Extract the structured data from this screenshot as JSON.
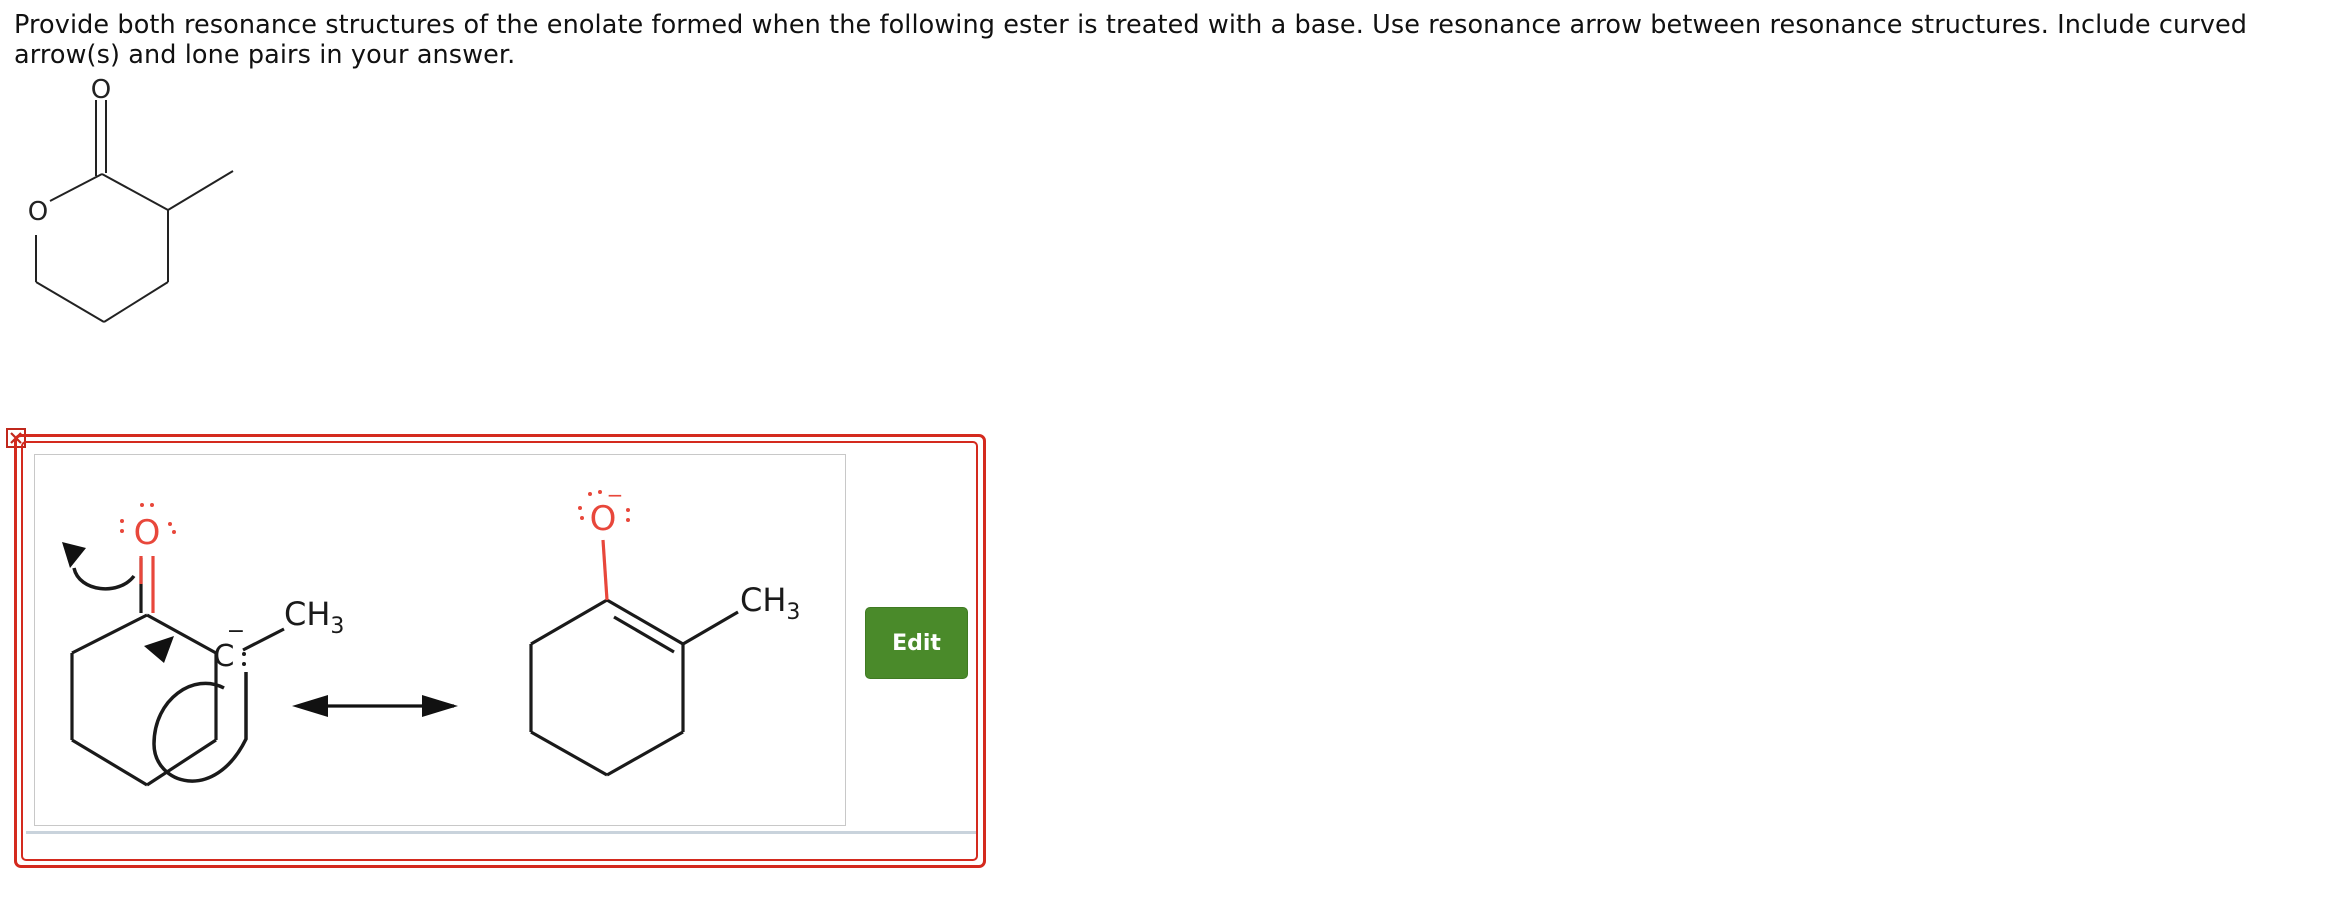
{
  "question": {
    "text": "Provide both resonance structures of the enolate formed when the following ester is treated with a base. Use resonance arrow between resonance structures. Include curved arrow(s) and lone pairs in your answer."
  },
  "given_structure": {
    "carbonyl_oxygen_label": "O",
    "ring_oxygen_label": "O"
  },
  "answer": {
    "structure1": {
      "oxygen_label": "O",
      "carbanion_label": "C",
      "charge_label": "−",
      "methyl_label": "CH",
      "methyl_subscript": "3"
    },
    "structure2": {
      "oxygen_label": "O",
      "charge_label": "−",
      "methyl_label": "CH",
      "methyl_subscript": "3"
    },
    "resonance_arrow": "double-headed-arrow"
  },
  "edit_button": {
    "label": "Edit",
    "color": "#4a8a2a"
  },
  "error_icon": "close-icon",
  "colors": {
    "error_border": "#d42a1e",
    "oxygen": "#e8473b",
    "bond": "#1a1a1a"
  }
}
